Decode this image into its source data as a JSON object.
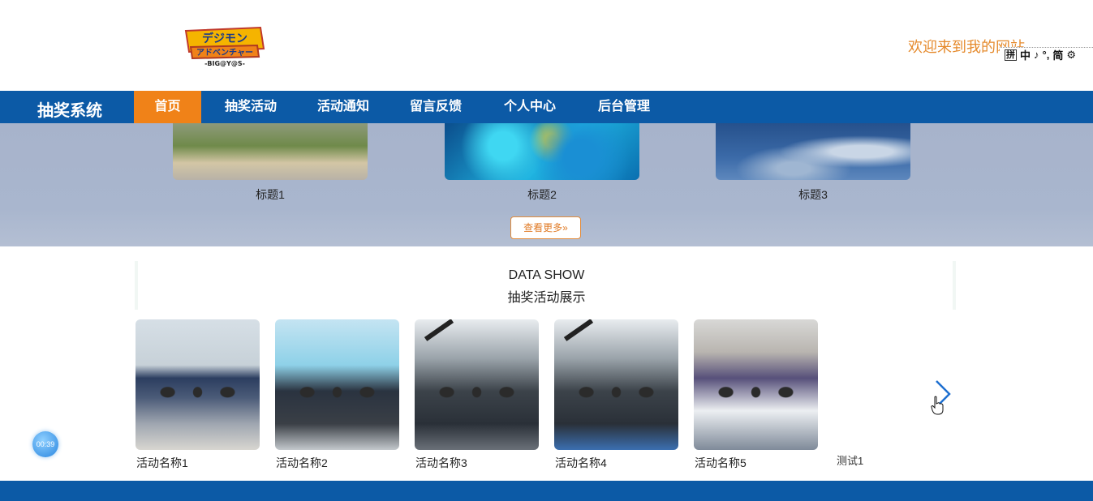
{
  "header": {
    "logo_text": "デジモンアドベンチャー -BIG@Y@S-",
    "welcome": "欢迎来到我的网站",
    "ime": {
      "box": "拼",
      "items": [
        "中",
        "♪",
        "°,",
        "简",
        "⚙"
      ]
    }
  },
  "nav": {
    "brand": "抽奖系统",
    "items": [
      {
        "label": "首页",
        "active": true
      },
      {
        "label": "抽奖活动"
      },
      {
        "label": "活动通知"
      },
      {
        "label": "留言反馈"
      },
      {
        "label": "个人中心"
      },
      {
        "label": "后台管理"
      }
    ]
  },
  "banner": {
    "cards": [
      {
        "title": "标题1"
      },
      {
        "title": "标题2"
      },
      {
        "title": "标题3"
      }
    ],
    "more": "查看更多»"
  },
  "datashow": {
    "title": "DATA SHOW",
    "subtitle": "抽奖活动展示",
    "activities": [
      {
        "name": "活动名称1"
      },
      {
        "name": "活动名称2"
      },
      {
        "name": "活动名称3"
      },
      {
        "name": "活动名称4"
      },
      {
        "name": "活动名称5"
      }
    ],
    "extra": "测试1"
  },
  "timer": "00:39",
  "colors": {
    "nav": "#0c5aa6",
    "active": "#f08218",
    "welcome": "#e58a2c"
  }
}
